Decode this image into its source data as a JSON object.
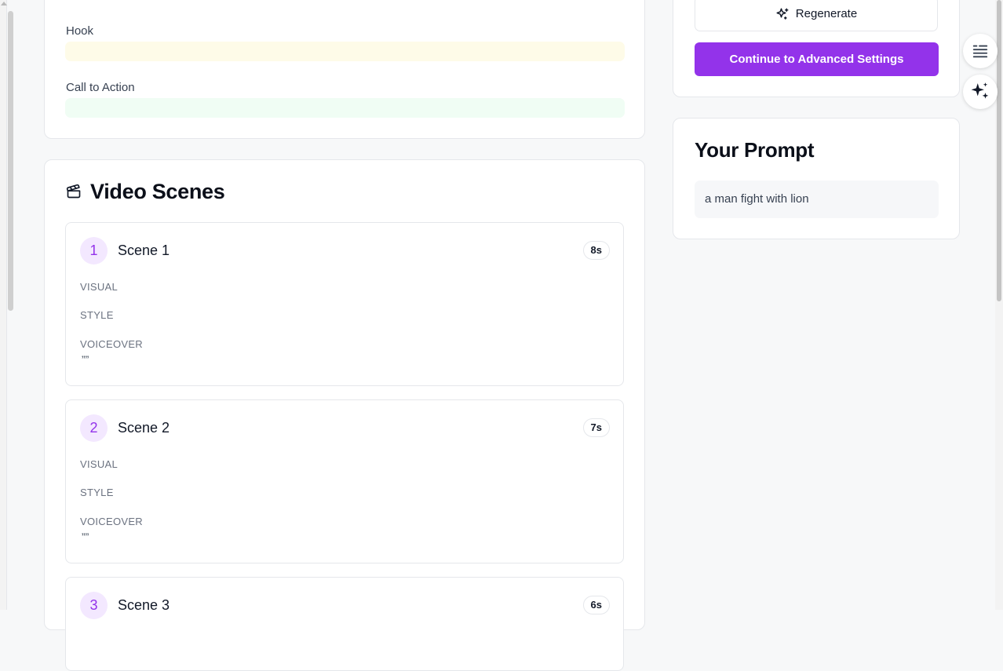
{
  "script": {
    "hook_label": "Hook",
    "cta_label": "Call to Action",
    "hook_color": "#fefbe8",
    "cta_color": "#f0fdf4"
  },
  "scenes_section": {
    "title": "Video Scenes",
    "icon": "clapperboard-icon",
    "scenes": [
      {
        "number": "1",
        "name": "Scene 1",
        "duration": "8s",
        "visual_label": "VISUAL",
        "style_label": "STYLE",
        "voiceover_label": "VOICEOVER",
        "voiceover": "””"
      },
      {
        "number": "2",
        "name": "Scene 2",
        "duration": "7s",
        "visual_label": "VISUAL",
        "style_label": "STYLE",
        "voiceover_label": "VOICEOVER",
        "voiceover": "””"
      },
      {
        "number": "3",
        "name": "Scene 3",
        "duration": "6s"
      }
    ]
  },
  "actions": {
    "regenerate_label": "Regenerate",
    "continue_label": "Continue to Advanced Settings",
    "accent_color": "#9333ea"
  },
  "prompt_panel": {
    "title": "Your Prompt",
    "prompt_text": "a man fight with lion"
  },
  "floating": {
    "chat_icon": "chat-list-icon",
    "ai_icon": "sparkle-icon"
  }
}
